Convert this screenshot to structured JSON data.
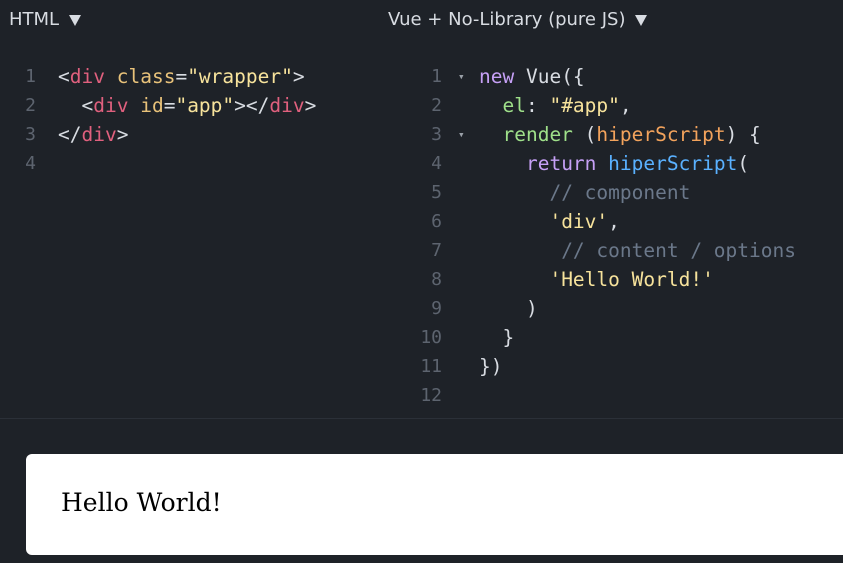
{
  "panes": {
    "html": {
      "title": "HTML"
    },
    "js": {
      "title": "Vue + No-Library (pure JS)"
    }
  },
  "html_code": {
    "lines": [
      {
        "num": "1",
        "tokens": [
          {
            "t": "<",
            "c": "punct"
          },
          {
            "t": "div",
            "c": "tag"
          },
          {
            "t": " ",
            "c": "punct"
          },
          {
            "t": "class",
            "c": "attr"
          },
          {
            "t": "=",
            "c": "punct"
          },
          {
            "t": "\"wrapper\"",
            "c": "str"
          },
          {
            "t": ">",
            "c": "punct"
          }
        ]
      },
      {
        "num": "2",
        "tokens": [
          {
            "t": "  <",
            "c": "punct"
          },
          {
            "t": "div",
            "c": "tag"
          },
          {
            "t": " ",
            "c": "punct"
          },
          {
            "t": "id",
            "c": "attr"
          },
          {
            "t": "=",
            "c": "punct"
          },
          {
            "t": "\"app\"",
            "c": "str"
          },
          {
            "t": "></",
            "c": "punct"
          },
          {
            "t": "div",
            "c": "tag"
          },
          {
            "t": ">",
            "c": "punct"
          }
        ]
      },
      {
        "num": "3",
        "tokens": [
          {
            "t": "</",
            "c": "punct"
          },
          {
            "t": "div",
            "c": "tag"
          },
          {
            "t": ">",
            "c": "punct"
          }
        ]
      },
      {
        "num": "4",
        "tokens": []
      }
    ]
  },
  "js_code": {
    "lines": [
      {
        "num": "1",
        "fold": true,
        "tokens": [
          {
            "t": "new",
            "c": "kw"
          },
          {
            "t": " Vue({",
            "c": "punct"
          }
        ]
      },
      {
        "num": "2",
        "tokens": [
          {
            "t": "  ",
            "c": "punct"
          },
          {
            "t": "el",
            "c": "prop"
          },
          {
            "t": ": ",
            "c": "punct"
          },
          {
            "t": "\"#app\"",
            "c": "str"
          },
          {
            "t": ",",
            "c": "punct"
          }
        ]
      },
      {
        "num": "3",
        "fold": true,
        "tokens": [
          {
            "t": "  ",
            "c": "punct"
          },
          {
            "t": "render",
            "c": "prop"
          },
          {
            "t": " (",
            "c": "punct"
          },
          {
            "t": "hiperScript",
            "c": "param"
          },
          {
            "t": ") {",
            "c": "punct"
          }
        ]
      },
      {
        "num": "4",
        "tokens": [
          {
            "t": "    ",
            "c": "punct"
          },
          {
            "t": "return",
            "c": "kw"
          },
          {
            "t": " ",
            "c": "punct"
          },
          {
            "t": "hiperScript",
            "c": "fn"
          },
          {
            "t": "(",
            "c": "punct"
          }
        ]
      },
      {
        "num": "5",
        "tokens": [
          {
            "t": "      ",
            "c": "punct"
          },
          {
            "t": "// component",
            "c": "comment"
          }
        ]
      },
      {
        "num": "6",
        "tokens": [
          {
            "t": "      ",
            "c": "punct"
          },
          {
            "t": "'div'",
            "c": "str"
          },
          {
            "t": ",",
            "c": "punct"
          }
        ]
      },
      {
        "num": "7",
        "tokens": [
          {
            "t": "       ",
            "c": "punct"
          },
          {
            "t": "// content / options",
            "c": "comment"
          }
        ]
      },
      {
        "num": "8",
        "tokens": [
          {
            "t": "      ",
            "c": "punct"
          },
          {
            "t": "'Hello World!'",
            "c": "str"
          }
        ]
      },
      {
        "num": "9",
        "tokens": [
          {
            "t": "    )",
            "c": "punct"
          }
        ]
      },
      {
        "num": "10",
        "tokens": [
          {
            "t": "  }",
            "c": "punct"
          }
        ]
      },
      {
        "num": "11",
        "tokens": [
          {
            "t": "})",
            "c": "punct"
          }
        ]
      },
      {
        "num": "12",
        "tokens": []
      }
    ]
  },
  "result": {
    "text": "Hello World!"
  },
  "icons": {
    "dropdown": "chevron-down-icon",
    "fold": "fold-arrow-icon"
  },
  "colors": {
    "background": "#1e2228",
    "tag": "#e0607e",
    "attr": "#e8c27a",
    "string": "#f7e39c",
    "keyword": "#c6a0f6",
    "property": "#9fe08a",
    "function": "#5ab1ff",
    "param": "#f3a35c",
    "comment": "#6b788a"
  }
}
